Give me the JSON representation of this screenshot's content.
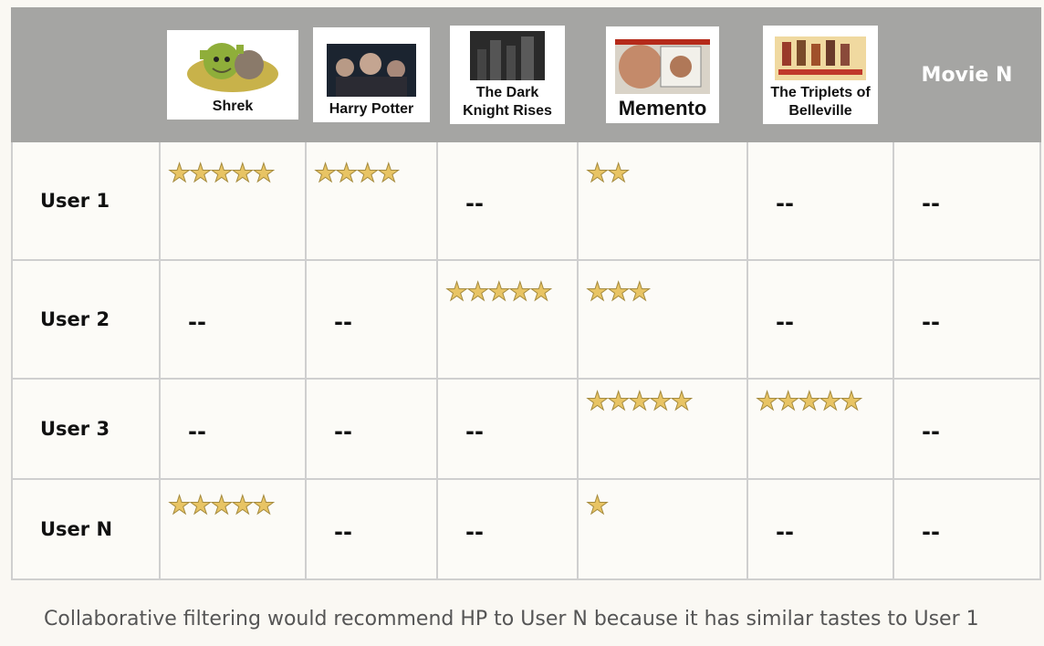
{
  "header": {
    "movies": [
      {
        "title": "Shrek",
        "icon": "shrek-poster-icon"
      },
      {
        "title": "Harry Potter",
        "icon": "harry-potter-poster-icon"
      },
      {
        "title": "The Dark\nKnight Rises",
        "icon": "dark-knight-poster-icon"
      },
      {
        "title": "Memento",
        "icon": "memento-poster-icon"
      },
      {
        "title": "The Triplets of\nBelleville",
        "icon": "triplets-poster-icon"
      },
      {
        "title": "Movie N"
      }
    ]
  },
  "rows": [
    {
      "user": "User 1",
      "ratings": [
        "★★★★★",
        "★★★★",
        "--",
        "★★",
        "--",
        "--"
      ]
    },
    {
      "user": "User 2",
      "ratings": [
        "--",
        "--",
        "★★★★★",
        "★★★",
        "--",
        "--"
      ]
    },
    {
      "user": "User 3",
      "ratings": [
        "--",
        "--",
        "--",
        "★★★★★",
        "★★★★★",
        "--"
      ]
    },
    {
      "user": "User N",
      "ratings": [
        "★★★★★",
        "--",
        "--",
        "★",
        "--",
        "--"
      ]
    }
  ],
  "caption": "Collaborative filtering would recommend HP to User N because it has similar tastes to User 1",
  "colors": {
    "header": "#a5a5a3",
    "star": "#e8c464",
    "grid": "#cfcfcf",
    "cell": "#fcfbf7"
  }
}
